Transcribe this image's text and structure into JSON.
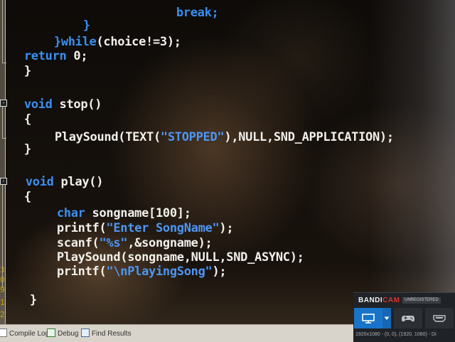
{
  "code_lines": [
    "        break;",
    "        }",
    "    }while(choice!=3);",
    "return 0;",
    "}",
    "",
    "void stop()",
    "{",
    "    PlaySound(TEXT(\"STOPPED\"),NULL,SND_APPLICATION);",
    "}",
    "",
    "void play()",
    "{",
    "    char songname[100];",
    "    printf(\"Enter SongName\");",
    "    scanf(\"%s\",&songname);",
    "    PlaySound(songname,NULL,SND_ASYNC);",
    "    printf(\"\\nPlayingSong\");",
    "",
    "}"
  ],
  "code": {
    "l0_kw": "break;",
    "l1": "}",
    "l2_a": "}",
    "l2_kw": "while",
    "l2_b": "(choice!=3);",
    "l3_kw": "return",
    "l3_b": " 0;",
    "l4": "}",
    "l6_kw": "void",
    "l6_b": " stop()",
    "l7": "{",
    "l8_a": "PlaySound(TEXT(",
    "l8_str": "\"STOPPED\"",
    "l8_b": "),NULL,SND_APPLICATION);",
    "l9": "}",
    "l11_kw": "void",
    "l11_b": " play()",
    "l12": "{",
    "l13_kw": "char",
    "l13_b": " songname[100];",
    "l14_a": "printf(",
    "l14_str": "\"Enter SongName\"",
    "l14_b": ");",
    "l15_a": "scanf(",
    "l15_str": "\"%s\"",
    "l15_b": ",&songname);",
    "l16": "PlaySound(songname,NULL,SND_ASYNC);",
    "l17_a": "printf(",
    "l17_str": "\"\\nPlayingSong\"",
    "l17_b": ");",
    "l19": "}"
  },
  "gutter": {
    "line_numbers": [
      "3",
      "0",
      "9",
      "1",
      "2"
    ],
    "fold_markers": [
      "-",
      "-"
    ]
  },
  "statusbar": {
    "compile_log": "Compile Log",
    "debug": "Debug",
    "find_results": "Find Results"
  },
  "bandicam": {
    "brand_a": "BANDI",
    "brand_b": "CAM",
    "unregistered": "UNREGISTERED",
    "status": "1920x1080 - (0, 0), (1920, 1080) - Di"
  },
  "colors": {
    "keyword": "#3a8ff0",
    "string": "#4d96f2",
    "text": "#f2f0ea",
    "line_number": "#c6a400",
    "bandicam_red": "#d8342f",
    "bandicam_blue": "#1874c9"
  },
  "icons": {
    "compile_log": "document-icon",
    "debug": "check-icon",
    "find_results": "search-icon",
    "screen_mode": "monitor-icon",
    "game_mode": "gamepad-icon",
    "device_mode": "hdmi-icon",
    "dropdown": "chevron-down-icon"
  }
}
